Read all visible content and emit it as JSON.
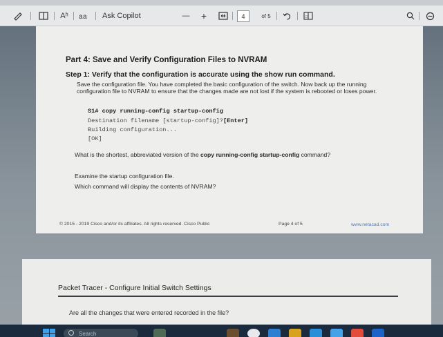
{
  "toolbar": {
    "read_aloud_label": "Aʱ",
    "ask_copilot_label": "Ask Copilot",
    "zoom_out": "—",
    "zoom_in": "+",
    "current_page": "4",
    "page_total": "of 5"
  },
  "doc": {
    "part_heading": "Part 4: Save and Verify Configuration Files to NVRAM",
    "step_heading": "Step 1: Verify that the configuration is accurate using the show run command.",
    "paragraph": "Save the configuration file. You have completed the basic configuration of the switch. Now back up the running configuration file to NVRAM to ensure that the changes made are not lost if the system is rebooted or loses power.",
    "cli": {
      "line1_prompt": "S1# ",
      "line1_cmd": "copy running-config startup-config",
      "line2_text": "Destination filename [startup-config]?",
      "line2_key": "[Enter]",
      "line3": "Building configuration...",
      "line4": "[OK]"
    },
    "question1_pre": "What is the shortest, abbreviated version of the ",
    "question1_bold": "copy running-config startup-config",
    "question1_post": " command?",
    "examine": "Examine the startup configuration file.",
    "question2": "Which command will display the contents of NVRAM?",
    "footer_copyright": "© 2015 - 2019 Cisco and/or its affiliates. All rights reserved. Cisco Public",
    "footer_page": "Page 4 of 5",
    "footer_link": "www.netacad.com"
  },
  "next_page": {
    "title": "Packet Tracer - Configure Initial Switch Settings",
    "question": "Are all the changes that were entered recorded in the file?"
  },
  "taskbar": {
    "search_placeholder": "Search"
  },
  "colors": {
    "toolbar_bg": "#e6e8ea",
    "page_bg": "#eeeeec",
    "taskbar_bg": "#1b2a3c",
    "windows_blue": "#3fa0ea",
    "link_blue": "#5a78a8"
  }
}
